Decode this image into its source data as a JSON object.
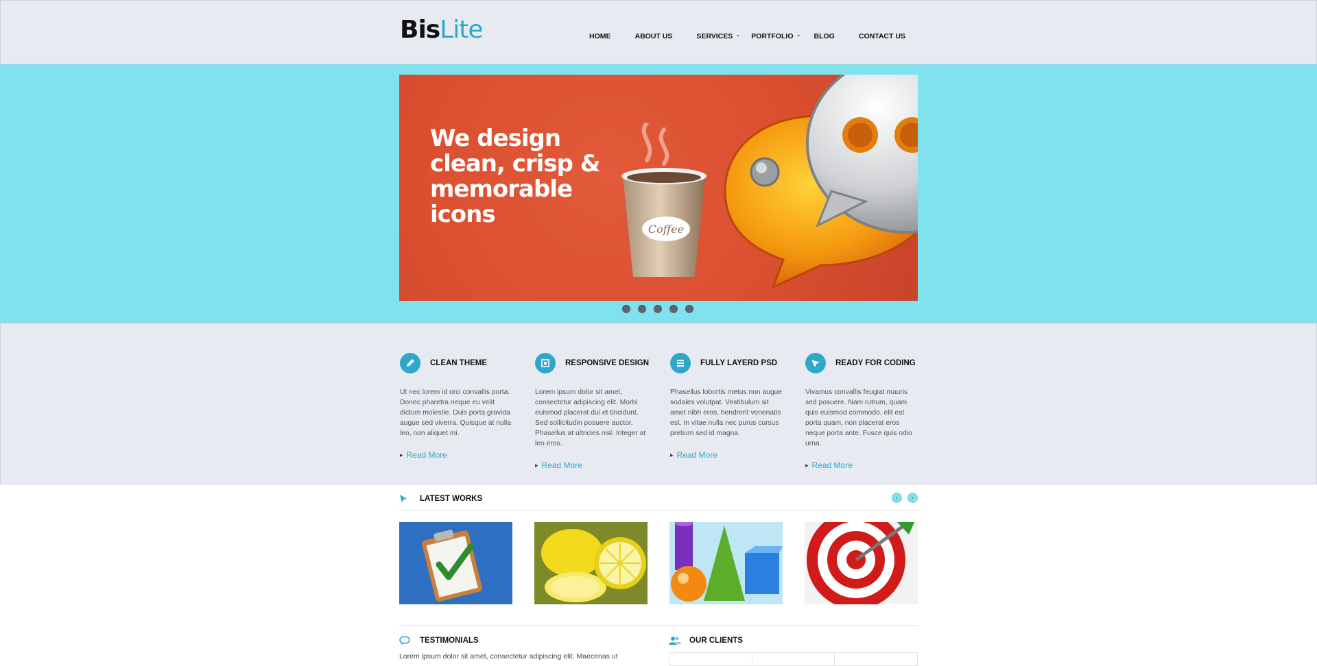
{
  "brand": {
    "part1": "Bis",
    "part2": "Lite",
    "accent": "#2ea8c9"
  },
  "nav": {
    "items": [
      {
        "label": "HOME"
      },
      {
        "label": "ABOUT US"
      },
      {
        "label": "SERVICES"
      },
      {
        "label": "PORTFOLIO"
      },
      {
        "label": "BLOG"
      },
      {
        "label": "CONTACT US"
      }
    ]
  },
  "hero": {
    "headline_1": "We design",
    "headline_2": "clean, crisp &",
    "headline_3": "memorable",
    "headline_4": "icons",
    "cup_label": "Coffee",
    "slide_count": 5,
    "background": "#80e2ec"
  },
  "features": [
    {
      "icon": "pencil-icon",
      "title": "CLEAN THEME",
      "text": "Ut nec lorem id orci convallis porta. Donec pharetra neque eu velit dictum molestie. Duis porta gravida augue sed viverra. Quisque at nulla leo, non aliquet mi.",
      "link": "Read More"
    },
    {
      "icon": "responsive-icon",
      "title": "RESPONSIVE DESIGN",
      "text": "Lorem ipsum dolor sit amet, consectetur adipiscing elit. Morbi euismod placerat dui et tincidunt. Sed sollicitudin posuere auctor. Phasellus at ultricies nisl. Integer at leo eros.",
      "link": "Read More"
    },
    {
      "icon": "layers-icon",
      "title": "FULLY LAYERD PSD",
      "text": "Phasellus lobortis metus non augue sodales volutpat. Vestibulum sit amet nibh eros, hendrerit venenatis est. In vitae nulla nec purus cursus pretium sed id magna.",
      "link": "Read More"
    },
    {
      "icon": "cursor-icon",
      "title": "READY FOR CODING",
      "text": "Vivamus convallis feugiat mauris sed posuere. Nam rutrum, quam quis euismod commodo, elit est porta quam, non placerat eros neque porta ante. Fusce quis odio urna.",
      "link": "Read More"
    }
  ],
  "latest_works": {
    "title": "LATEST WORKS",
    "prev": "‹",
    "next": "›",
    "items": [
      "clipboard-check",
      "lemons",
      "3d-shapes",
      "target-dart"
    ]
  },
  "testimonials": {
    "title": "TESTIMONIALS",
    "text": "Lorem ipsum dolor sit amet, consectetur adipiscing elit. Maecenas ut"
  },
  "clients": {
    "title": "OUR CLIENTS"
  }
}
